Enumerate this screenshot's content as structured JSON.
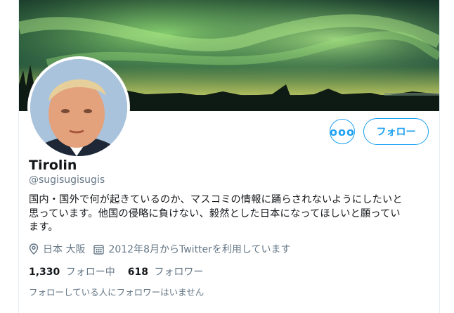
{
  "profile": {
    "name": "Tirolin",
    "handle": "@sugisugisugis",
    "bio_line1": "国内・国外で何が起きているのか、マスコミの情報に踊らされないようにしたいと",
    "bio_line2": "思っています。他国の侵略に負けない、毅然とした日本になってほしいと願ってい",
    "bio_line3": "ます。",
    "location": "日本 大阪",
    "joined": "2012年8月からTwitterを利用しています"
  },
  "actions": {
    "more_label": "ooo",
    "follow_label": "フォロー"
  },
  "stats": {
    "following_count": "1,330",
    "following_label": "フォロー中",
    "followers_count": "618",
    "followers_label": "フォロワー"
  },
  "known_followers": "フォローしている人にフォロワーはいません",
  "icons": {
    "location": "map-pin-icon",
    "joined": "calendar-icon",
    "more": "more-options-icon"
  },
  "colors": {
    "accent": "#1da1f2",
    "secondary_text": "#657786",
    "primary_text": "#14171a"
  }
}
